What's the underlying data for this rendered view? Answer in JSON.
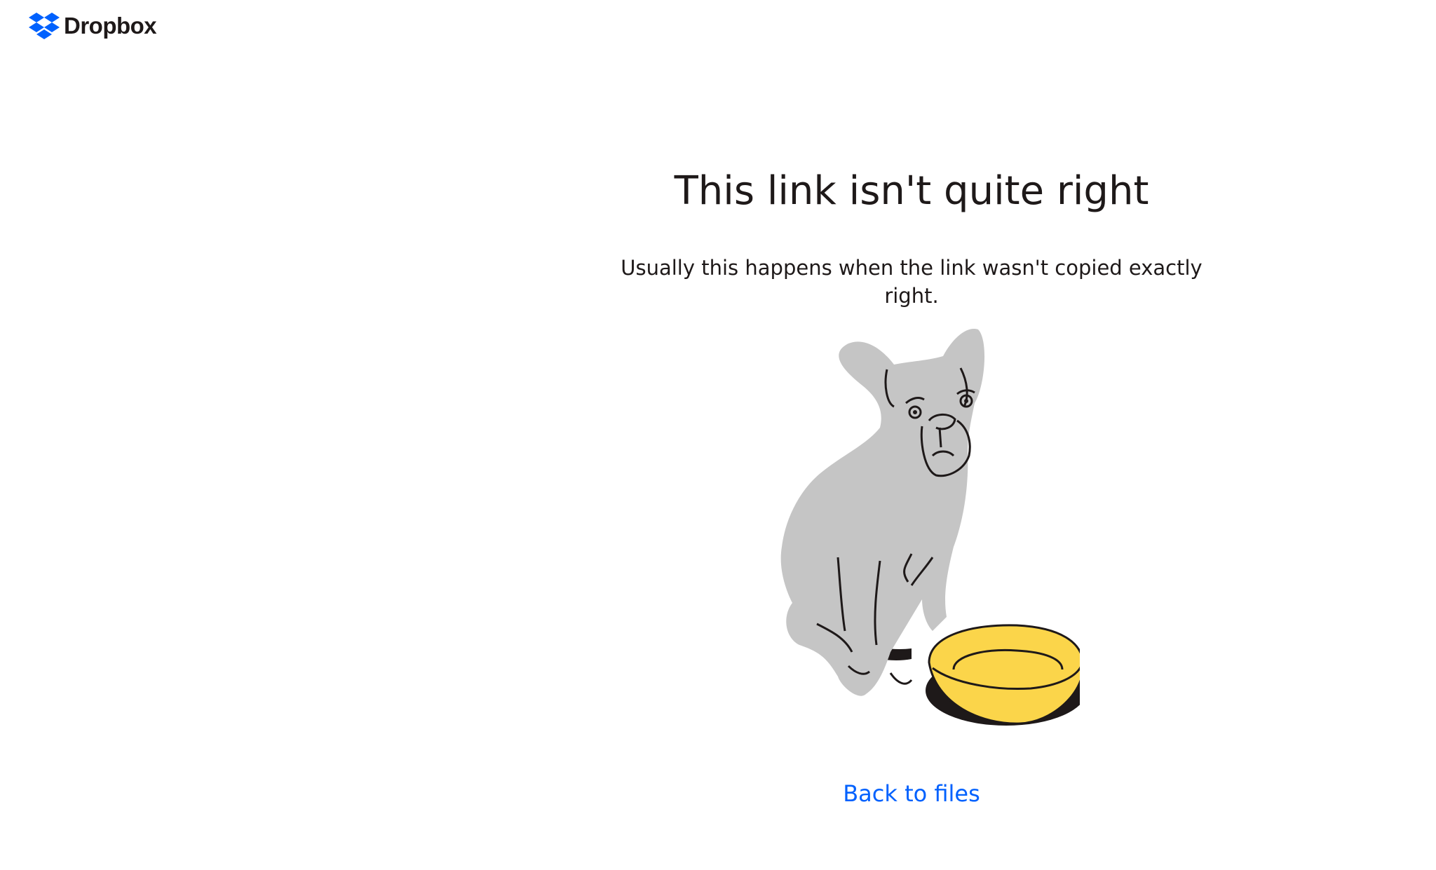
{
  "header": {
    "brand_name": "Dropbox",
    "brand_color": "#0061fe",
    "logo_icon": "dropbox-logo-icon"
  },
  "main": {
    "title": "This link isn't quite right",
    "subtitle": "Usually this happens when the link wasn't copied exactly right.",
    "illustration_icon": "sad-dog-with-empty-bowl-illustration",
    "back_link_label": "Back to files",
    "link_color": "#0061fe"
  }
}
